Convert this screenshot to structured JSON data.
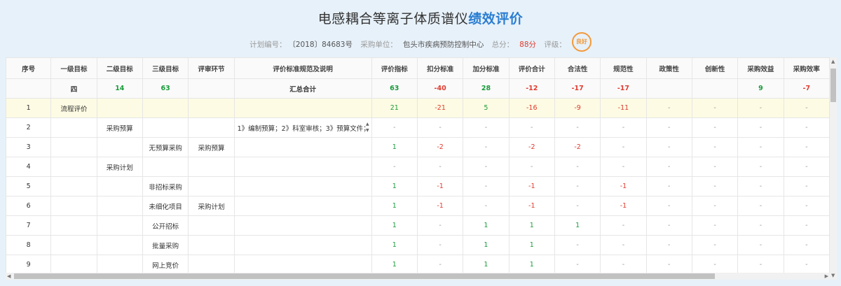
{
  "header": {
    "title_main": "电感耦合等离子体质谱仪",
    "title_highlight": "绩效评价",
    "plan_label": "计划编号：",
    "plan_value": "〔2018〕84683号",
    "unit_label": "采购单位：",
    "unit_value": "包头市疾病预防控制中心",
    "score_label": "总分：",
    "score_value": "88分",
    "grade_label": "评级：",
    "grade_value": "良好"
  },
  "table": {
    "columns": [
      "序号",
      "一级目标",
      "二级目标",
      "三级目标",
      "评审环节",
      "评价标准规范及说明",
      "评价指标",
      "扣分标准",
      "加分标准",
      "评价合计",
      "合法性",
      "规范性",
      "政策性",
      "创新性",
      "采购效益",
      "采购效率"
    ],
    "summary": [
      "",
      "四",
      "14",
      "63",
      "",
      "汇总合计",
      "63",
      "-40",
      "28",
      "-12",
      "-17",
      "-17",
      "",
      "",
      "9",
      "-7"
    ],
    "rows": [
      [
        "1",
        "流程评价",
        "",
        "",
        "",
        "",
        "21",
        "-21",
        "5",
        "-16",
        "-9",
        "-11",
        "-",
        "-",
        "-",
        "-"
      ],
      [
        "2",
        "",
        "采购预算",
        "",
        "",
        "1》编制预算；2》科室审核；3》预算文件；",
        "-",
        "-",
        "-",
        "-",
        "-",
        "-",
        "-",
        "-",
        "-",
        "-"
      ],
      [
        "3",
        "",
        "",
        "无预算采购",
        "采购预算",
        "",
        "1",
        "-2",
        "-",
        "-2",
        "-2",
        "-",
        "-",
        "-",
        "-",
        "-"
      ],
      [
        "4",
        "",
        "采购计划",
        "",
        "",
        "",
        "-",
        "-",
        "-",
        "-",
        "-",
        "-",
        "-",
        "-",
        "-",
        "-"
      ],
      [
        "5",
        "",
        "",
        "非招标采购",
        "",
        "",
        "1",
        "-1",
        "-",
        "-1",
        "-",
        "-1",
        "-",
        "-",
        "-",
        "-"
      ],
      [
        "6",
        "",
        "",
        "未细化项目",
        "采购计划",
        "",
        "1",
        "-1",
        "-",
        "-1",
        "-",
        "-1",
        "-",
        "-",
        "-",
        "-"
      ],
      [
        "7",
        "",
        "",
        "公开招标",
        "",
        "",
        "1",
        "-",
        "1",
        "1",
        "1",
        "-",
        "-",
        "-",
        "-",
        "-"
      ],
      [
        "8",
        "",
        "",
        "批量采购",
        "",
        "",
        "1",
        "-",
        "1",
        "1",
        "-",
        "-",
        "-",
        "-",
        "-",
        "-"
      ],
      [
        "9",
        "",
        "",
        "网上竞价",
        "",
        "",
        "1",
        "-",
        "1",
        "1",
        "-",
        "-",
        "-",
        "-",
        "-",
        "-"
      ]
    ]
  },
  "colors": {
    "green": "#1a9c3c",
    "red": "#e03b30",
    "accent": "#2a7dd1",
    "highlight_row": "#fdfbe3",
    "seal": "#f39a3a"
  }
}
